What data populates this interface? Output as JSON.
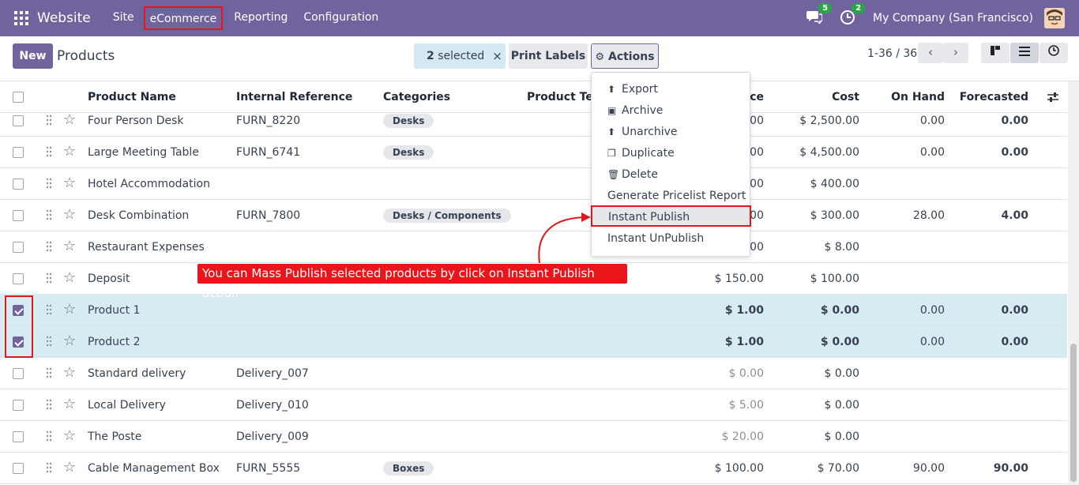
{
  "navbar": {
    "brand": "Website",
    "menu": [
      "Site",
      "eCommerce",
      "Reporting",
      "Configuration"
    ],
    "messages_count": "5",
    "activities_count": "2",
    "company": "My Company (San Francisco)"
  },
  "control": {
    "new_label": "New",
    "title": "Products",
    "selected_count": "2",
    "selected_suffix": " selected",
    "clear_icon": "×",
    "print_labels": "Print Labels",
    "actions": "Actions",
    "pager": "1-36 / 36"
  },
  "columns": [
    "Product Name",
    "Internal Reference",
    "Categories",
    "Product Tem",
    "ice",
    "Cost",
    "On Hand",
    "Forecasted"
  ],
  "rows": [
    {
      "name": "Four Person Desk",
      "ref": "FURN_8220",
      "category": "Desks",
      "price": ".00",
      "cost": "$ 2,500.00",
      "onhand": "0.00",
      "forecast": "0.00",
      "selected": false
    },
    {
      "name": "Large Meeting Table",
      "ref": "FURN_6741",
      "category": "Desks",
      "price": ".00",
      "cost": "$ 4,500.00",
      "onhand": "0.00",
      "forecast": "0.00",
      "selected": false
    },
    {
      "name": "Hotel Accommodation",
      "ref": "",
      "category": "",
      "price": ".00",
      "cost": "$ 400.00",
      "onhand": "",
      "forecast": "",
      "selected": false
    },
    {
      "name": "Desk Combination",
      "ref": "FURN_7800",
      "category": "Desks / Components",
      "price": ".00",
      "cost": "$ 300.00",
      "onhand": "28.00",
      "forecast": "4.00",
      "selected": false
    },
    {
      "name": "Restaurant Expenses",
      "ref": "",
      "category": "",
      "price": ".00",
      "cost": "$ 8.00",
      "onhand": "",
      "forecast": "",
      "selected": false
    },
    {
      "name": "Deposit",
      "ref": "",
      "category": "",
      "price": "$ 150.00",
      "cost": "$ 100.00",
      "onhand": "",
      "forecast": "",
      "selected": false
    },
    {
      "name": "Product 1",
      "ref": "",
      "category": "",
      "price": "$ 1.00",
      "cost": "$ 0.00",
      "onhand": "0.00",
      "forecast": "0.00",
      "selected": true
    },
    {
      "name": "Product 2",
      "ref": "",
      "category": "",
      "price": "$ 1.00",
      "cost": "$ 0.00",
      "onhand": "0.00",
      "forecast": "0.00",
      "selected": true
    },
    {
      "name": "Standard delivery",
      "ref": "Delivery_007",
      "category": "",
      "price": "$ 0.00",
      "cost": "$ 0.00",
      "onhand": "",
      "forecast": "",
      "selected": false,
      "muted_price": true
    },
    {
      "name": "Local Delivery",
      "ref": "Delivery_010",
      "category": "",
      "price": "$ 5.00",
      "cost": "$ 0.00",
      "onhand": "",
      "forecast": "",
      "selected": false,
      "muted_price": true
    },
    {
      "name": "The Poste",
      "ref": "Delivery_009",
      "category": "",
      "price": "$ 20.00",
      "cost": "$ 0.00",
      "onhand": "",
      "forecast": "",
      "selected": false,
      "muted_price": true
    },
    {
      "name": "Cable Management Box",
      "ref": "FURN_5555",
      "category": "Boxes",
      "price": "$ 100.00",
      "cost": "$ 70.00",
      "onhand": "90.00",
      "forecast": "90.00",
      "selected": false
    }
  ],
  "actions_menu": [
    {
      "label": "Export",
      "icon": "upload-icon",
      "glyph": "⬆"
    },
    {
      "label": "Archive",
      "icon": "archive-icon",
      "glyph": "▣"
    },
    {
      "label": "Unarchive",
      "icon": "unarchive-icon",
      "glyph": "⬆"
    },
    {
      "label": "Duplicate",
      "icon": "copy-icon",
      "glyph": "❐"
    },
    {
      "label": "Delete",
      "icon": "trash-icon",
      "glyph": "🗑"
    },
    {
      "label": "Generate Pricelist Report",
      "icon": "",
      "glyph": ""
    },
    {
      "label": "Instant Publish",
      "icon": "",
      "glyph": ""
    },
    {
      "label": "Instant UnPublish",
      "icon": "",
      "glyph": ""
    }
  ],
  "annotation": "You can Mass Publish selected products by click on Instant Publish action",
  "colors": {
    "brand": "#71639e",
    "highlight_red": "#e0181b",
    "selected_row": "#d7ecf2"
  }
}
